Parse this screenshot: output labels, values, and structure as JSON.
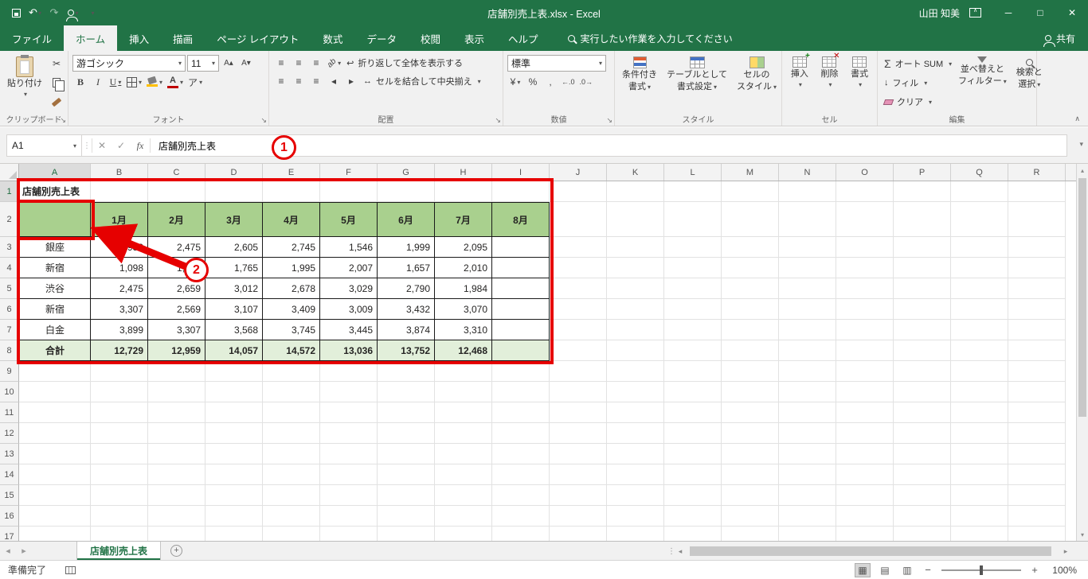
{
  "window": {
    "title": "店舗別売上表.xlsx - Excel",
    "user": "山田 知美"
  },
  "tabs": {
    "items": [
      "ファイル",
      "ホーム",
      "挿入",
      "描画",
      "ページ レイアウト",
      "数式",
      "データ",
      "校閲",
      "表示",
      "ヘルプ"
    ],
    "active": "ホーム",
    "search_placeholder": "実行したい作業を入力してください",
    "share": "共有"
  },
  "ribbon": {
    "clipboard": {
      "paste": "貼り付け",
      "group": "クリップボード"
    },
    "font": {
      "name": "游ゴシック",
      "size": "11",
      "group": "フォント"
    },
    "alignment": {
      "wrap": "折り返して全体を表示する",
      "merge": "セルを結合して中央揃え",
      "group": "配置"
    },
    "number": {
      "format": "標準",
      "group": "数値"
    },
    "styles": {
      "conditional": [
        "条件付き",
        "書式"
      ],
      "format_table": [
        "テーブルとして",
        "書式設定"
      ],
      "cell_styles": [
        "セルの",
        "スタイル"
      ],
      "group": "スタイル"
    },
    "cells": {
      "insert": "挿入",
      "delete": "削除",
      "format": "書式",
      "group": "セル"
    },
    "editing": {
      "autosum": "オート SUM",
      "fill": "フィル",
      "clear": "クリア",
      "sort": [
        "並べ替えと",
        "フィルター"
      ],
      "find": [
        "検索と",
        "選択"
      ],
      "group": "編集"
    }
  },
  "formula_bar": {
    "name_box": "A1",
    "formula": "店舗別売上表"
  },
  "sheet": {
    "columns": [
      "A",
      "B",
      "C",
      "D",
      "E",
      "F",
      "G",
      "H",
      "I",
      "J",
      "K",
      "L",
      "M",
      "N",
      "O",
      "P",
      "Q",
      "R"
    ],
    "row_count": 17,
    "title_cell": "店舗別売上表",
    "table": {
      "header_row": [
        "",
        "1月",
        "2月",
        "3月",
        "4月",
        "5月",
        "6月",
        "7月",
        "8月"
      ],
      "data_rows": [
        [
          "銀座",
          "1,950",
          "2,475",
          "2,605",
          "2,745",
          "1,546",
          "1,999",
          "2,095",
          ""
        ],
        [
          "新宿",
          "1,098",
          "1,949",
          "1,765",
          "1,995",
          "2,007",
          "1,657",
          "2,010",
          ""
        ],
        [
          "渋谷",
          "2,475",
          "2,659",
          "3,012",
          "2,678",
          "3,029",
          "2,790",
          "1,984",
          ""
        ],
        [
          "新宿",
          "3,307",
          "2,569",
          "3,107",
          "3,409",
          "3,009",
          "3,432",
          "3,070",
          ""
        ],
        [
          "白金",
          "3,899",
          "3,307",
          "3,568",
          "3,745",
          "3,445",
          "3,874",
          "3,310",
          ""
        ]
      ],
      "total_row": [
        "合計",
        "12,729",
        "12,959",
        "14,057",
        "14,572",
        "13,036",
        "13,752",
        "12,468",
        ""
      ]
    }
  },
  "annotations": {
    "step1": "1",
    "step2": "2"
  },
  "sheet_tabs": {
    "active": "店舗別売上表"
  },
  "status": {
    "mode": "準備完了",
    "zoom": "100%"
  },
  "colors": {
    "excel_green": "#217346",
    "table_header_fill": "#a9d08e",
    "total_row_fill": "#e2efda",
    "annotation_red": "#e60000"
  },
  "icons": {
    "dropdown": "▾",
    "undo": "↶",
    "redo": "↷",
    "cut": "✂",
    "check": "✓",
    "cancel": "✕",
    "fx": "fx",
    "sigma": "Σ",
    "fill_down": "↓",
    "wrap": "↩",
    "merge": "↔",
    "dialog": "↘",
    "nav_left": "◂",
    "nav_right": "▸",
    "scroll_up": "▴",
    "scroll_down": "▾",
    "minimize": "─",
    "maximize": "□",
    "close": "✕",
    "percent": "%",
    "comma": ",",
    "currency": "¥",
    "phonetic": "ア",
    "align": "≡",
    "orientation": "ab",
    "bold": "B",
    "italic": "I",
    "underline": "U",
    "increase_font": "A▴",
    "decrease_font": "A▾",
    "inc_decimal": "←.0",
    "dec_decimal": ".0→",
    "view_normal": "▦",
    "view_layout": "▤",
    "view_break": "▥",
    "minus": "−",
    "plus": "+",
    "new_sheet": "+",
    "collapse": "∧",
    "handle": "⋮"
  }
}
